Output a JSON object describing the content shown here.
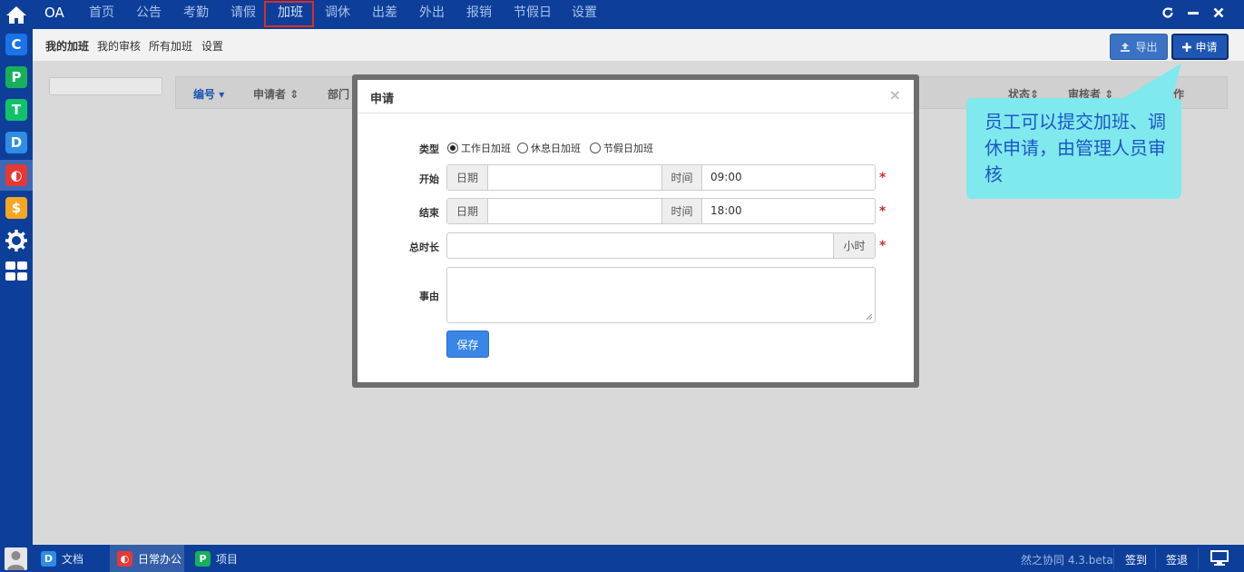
{
  "colors": {
    "nav_bg": "#0d3f9a",
    "nav_text": "#a9c0ea",
    "nav_active_outline": "#e02b20",
    "primary_button": "#3a86e6",
    "required_mark": "#c9302c",
    "callout_bg": "#7fe9ee",
    "callout_text": "#1f56c4"
  },
  "sidebar": {
    "home_icon": "home-icon",
    "apps": [
      {
        "icon": "c-app-icon",
        "letter": "C",
        "color": "#1a73e8"
      },
      {
        "icon": "p-app-icon",
        "letter": "P",
        "color": "#17b05a"
      },
      {
        "icon": "t-app-icon",
        "letter": "T",
        "color": "#12c26a"
      },
      {
        "icon": "d-app-icon",
        "letter": "D",
        "color": "#2f8de4"
      },
      {
        "icon": "o-app-icon",
        "letter": "◐",
        "color": "#e53935"
      },
      {
        "icon": "s-app-icon",
        "letter": "$",
        "color": "#f5a623"
      }
    ],
    "settings_icon": "gear-icon",
    "grid_icon": "grid-icon"
  },
  "topnav": {
    "logo": "OA",
    "items": [
      "首页",
      "公告",
      "考勤",
      "请假",
      "加班",
      "调休",
      "出差",
      "外出",
      "报销",
      "节假日",
      "设置"
    ],
    "active_item": "加班",
    "window_controls": [
      "refresh-icon",
      "minimize-icon",
      "close-icon"
    ]
  },
  "subnav": {
    "items": [
      "我的加班",
      "我的审核",
      "所有加班",
      "设置"
    ],
    "active_item": "我的加班",
    "export_label": "导出",
    "apply_label": "申请"
  },
  "table": {
    "headers": {
      "id": "编号",
      "applicant": "申请者",
      "department": "部门",
      "status": "状态",
      "reviewer": "审核者",
      "actions": "操作"
    }
  },
  "modal": {
    "title": "申请",
    "close_symbol": "×",
    "type_label": "类型",
    "type_options": [
      "工作日加班",
      "休息日加班",
      "节假日加班"
    ],
    "type_selected": "工作日加班",
    "start_label": "开始",
    "end_label": "结束",
    "date_addon": "日期",
    "time_addon": "时间",
    "start_date": "",
    "start_time": "09:00",
    "end_date": "",
    "end_time": "18:00",
    "duration_label": "总时长",
    "duration_value": "",
    "duration_unit": "小时",
    "reason_label": "事由",
    "reason_value": "",
    "required_mark": "*",
    "save_label": "保存"
  },
  "callout": {
    "text": "员工可以提交加班、调休申请，由管理人员审核"
  },
  "bottombar": {
    "tasks": [
      {
        "label": "文档",
        "icon": "d-app-icon",
        "letter": "D",
        "color": "#2f8de4",
        "active": false
      },
      {
        "label": "日常办公",
        "icon": "o-app-icon",
        "letter": "◐",
        "color": "#e53935",
        "active": true
      },
      {
        "label": "项目",
        "icon": "p-app-icon",
        "letter": "P",
        "color": "#17b05a",
        "active": false
      }
    ],
    "version": "然之协同 4.3.beta",
    "sign_in": "签到",
    "sign_out": "签退",
    "desktop_icon": "desktop-icon"
  }
}
